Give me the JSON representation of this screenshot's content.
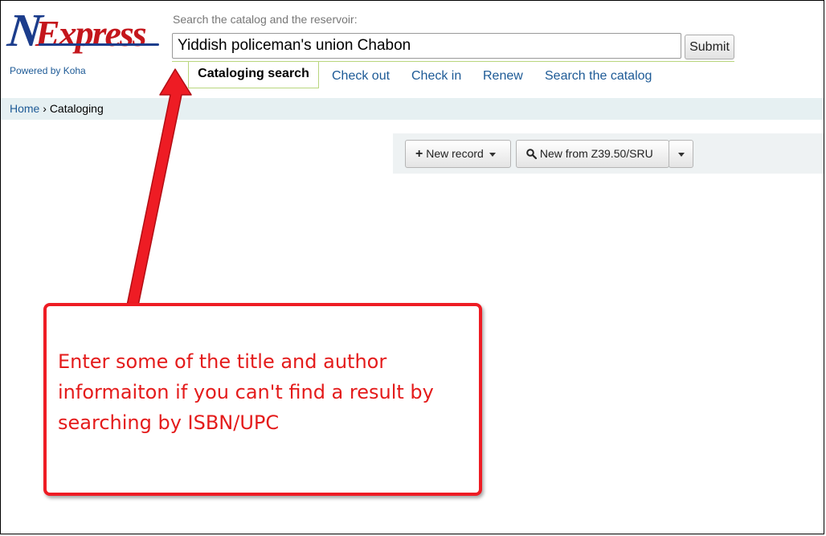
{
  "logo": {
    "letter_n": "N",
    "rest": "Express",
    "powered_by": "Powered by Koha"
  },
  "search": {
    "label": "Search the catalog and the reservoir:",
    "value": "Yiddish policeman's union Chabon",
    "submit_label": "Submit"
  },
  "tabs": {
    "active": "Cataloging search",
    "items": [
      "Check out",
      "Check in",
      "Renew",
      "Search the catalog"
    ]
  },
  "breadcrumb": {
    "home": "Home",
    "separator": "›",
    "current": "Cataloging"
  },
  "toolbar": {
    "new_record": "New record",
    "new_from_z3950": "New from Z39.50/SRU"
  },
  "annotation": {
    "text": "Enter some of the title and author informaiton if you can't find a result by searching by ISBN/UPC",
    "color": "#ee1c24"
  },
  "colors": {
    "link": "#1d5a96",
    "brand_blue": "#1c3d8c",
    "brand_red": "#c4161c",
    "tab_border": "#b9d67e",
    "breadcrumb_bg": "#e6f0f2"
  }
}
